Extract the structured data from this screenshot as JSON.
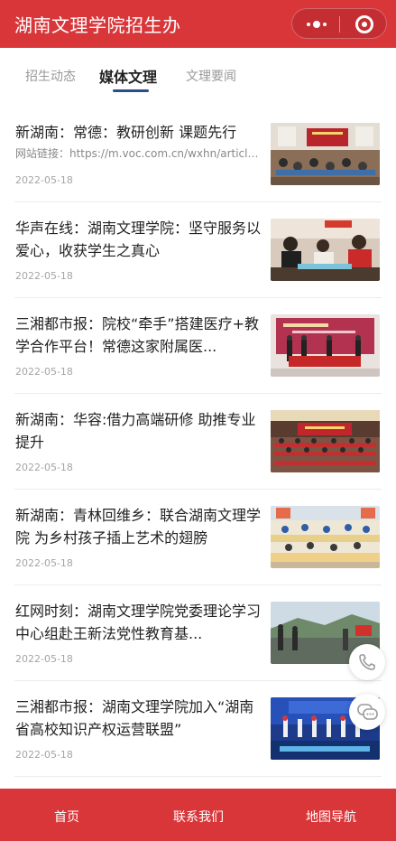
{
  "header": {
    "title": "湖南文理学院招生办",
    "menu_icon": "more-dots-icon",
    "close_icon": "target-circle-icon",
    "bg_color": "#d9363a"
  },
  "tabs": [
    {
      "label": "招生动态",
      "active": false
    },
    {
      "label": "媒体文理",
      "active": true
    },
    {
      "label": "文理要闻",
      "active": false
    }
  ],
  "articles": [
    {
      "title": "新湖南：常德：教研创新 课题先行",
      "subtitle": "网站链接：https://m.voc.com.cn/wxhn/article/2...",
      "date": "2022-05-18",
      "thumb": "classroom-meeting-photo"
    },
    {
      "title": "华声在线：湖南文理学院：坚守服务以爱心，收获学生之真心",
      "subtitle": "",
      "date": "2022-05-18",
      "thumb": "service-desk-photo"
    },
    {
      "title": "三湘都市报：院校“牵手”搭建医疗+教学合作平台！常德这家附属医...",
      "subtitle": "",
      "date": "2022-05-18",
      "thumb": "signing-ceremony-photo"
    },
    {
      "title": "新湖南：华容:借力高端研修 助推专业提升",
      "subtitle": "",
      "date": "2022-05-18",
      "thumb": "auditorium-photo"
    },
    {
      "title": "新湖南：青林回维乡：联合湖南文理学院 为乡村孩子插上艺术的翅膀",
      "subtitle": "",
      "date": "2022-05-18",
      "thumb": "children-classroom-photo"
    },
    {
      "title": "红网时刻：湖南文理学院党委理论学习中心组赴王新法党性教育基...",
      "subtitle": "",
      "date": "2022-05-18",
      "thumb": "outdoor-visit-photo"
    },
    {
      "title": "三湘都市报：湖南文理学院加入“湖南省高校知识产权运营联盟”",
      "subtitle": "",
      "date": "2022-05-18",
      "thumb": "stage-alliance-photo"
    }
  ],
  "floating": {
    "phone_icon": "phone-icon",
    "chat_icon": "chat-bubbles-icon"
  },
  "bottom_nav": [
    {
      "label": "首页"
    },
    {
      "label": "联系我们"
    },
    {
      "label": "地图导航"
    }
  ]
}
